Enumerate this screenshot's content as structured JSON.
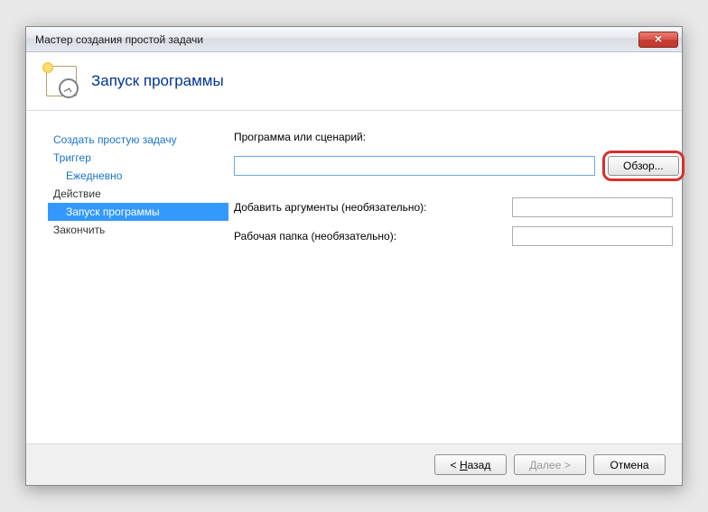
{
  "titlebar": {
    "title": "Мастер создания простой задачи"
  },
  "header": {
    "title": "Запуск программы"
  },
  "nav": {
    "create": "Создать простую задачу",
    "trigger": "Триггер",
    "trigger_sub": "Ежедневно",
    "action": "Действие",
    "action_sub": "Запуск программы",
    "finish": "Закончить"
  },
  "form": {
    "program_label": "Программа или сценарий:",
    "program_value": "",
    "browse_label": "Обзор...",
    "args_label": "Добавить аргументы (необязательно):",
    "args_value": "",
    "startin_label": "Рабочая папка (необязательно):",
    "startin_value": ""
  },
  "footer": {
    "back_prefix": "< ",
    "back_u": "Н",
    "back_rest": "азад",
    "next_prefix": "",
    "next_u": "Д",
    "next_rest": "алее >",
    "cancel": "Отмена"
  }
}
